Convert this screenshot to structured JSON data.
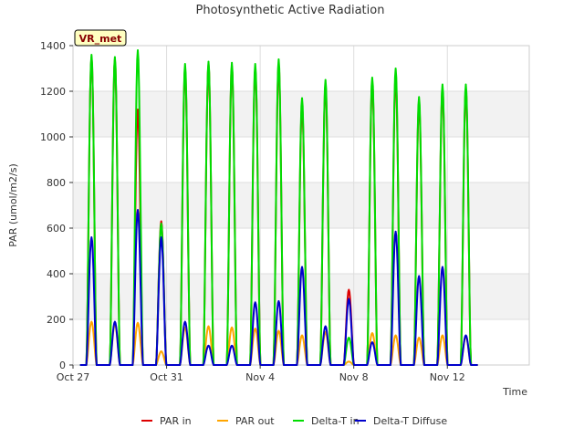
{
  "chart_data": {
    "type": "line",
    "title": "Photosynthetic Active Radiation",
    "xlabel": "Time",
    "ylabel": "PAR (umol/m2/s)",
    "site_label": "VR_met",
    "xlim": [
      0,
      19.5
    ],
    "ylim": [
      0,
      1400
    ],
    "x_ticks": [
      {
        "value": 0,
        "label": "Oct 27"
      },
      {
        "value": 4,
        "label": "Oct 31"
      },
      {
        "value": 8,
        "label": "Nov 4"
      },
      {
        "value": 12,
        "label": "Nov 8"
      },
      {
        "value": 16,
        "label": "Nov 12"
      }
    ],
    "y_ticks": [
      0,
      200,
      400,
      600,
      800,
      1000,
      1200,
      1400
    ],
    "grid": true,
    "background_bands": true,
    "legend_position": "bottom",
    "x_unit": "days since Oct 27",
    "day_peak_times": [
      0.79,
      1.79,
      2.77,
      3.77,
      4.79,
      5.79,
      6.79,
      7.79,
      8.79,
      9.79,
      10.79,
      11.79,
      12.79,
      13.79,
      14.79,
      15.79,
      16.79
    ],
    "series": [
      {
        "name": "PAR in",
        "color": "#dd0000",
        "daily_peaks": [
          1350,
          1340,
          1120,
          630,
          1300,
          1320,
          1310,
          1300,
          1320,
          1140,
          1230,
          330,
          1240,
          1270,
          1150,
          1210,
          1210
        ]
      },
      {
        "name": "PAR out",
        "color": "#ffa500",
        "daily_peaks": [
          190,
          180,
          185,
          60,
          165,
          170,
          165,
          160,
          150,
          130,
          145,
          15,
          140,
          130,
          120,
          130,
          125
        ]
      },
      {
        "name": "Delta-T in",
        "color": "#00dd00",
        "daily_peaks": [
          1360,
          1350,
          1380,
          620,
          1320,
          1330,
          1325,
          1320,
          1340,
          1170,
          1250,
          120,
          1260,
          1300,
          1175,
          1230,
          1230
        ]
      },
      {
        "name": "Delta-T Diffuse",
        "color": "#0000cc",
        "daily_peaks": [
          560,
          190,
          680,
          560,
          190,
          85,
          85,
          275,
          280,
          430,
          170,
          290,
          100,
          585,
          390,
          430,
          130
        ]
      }
    ]
  }
}
